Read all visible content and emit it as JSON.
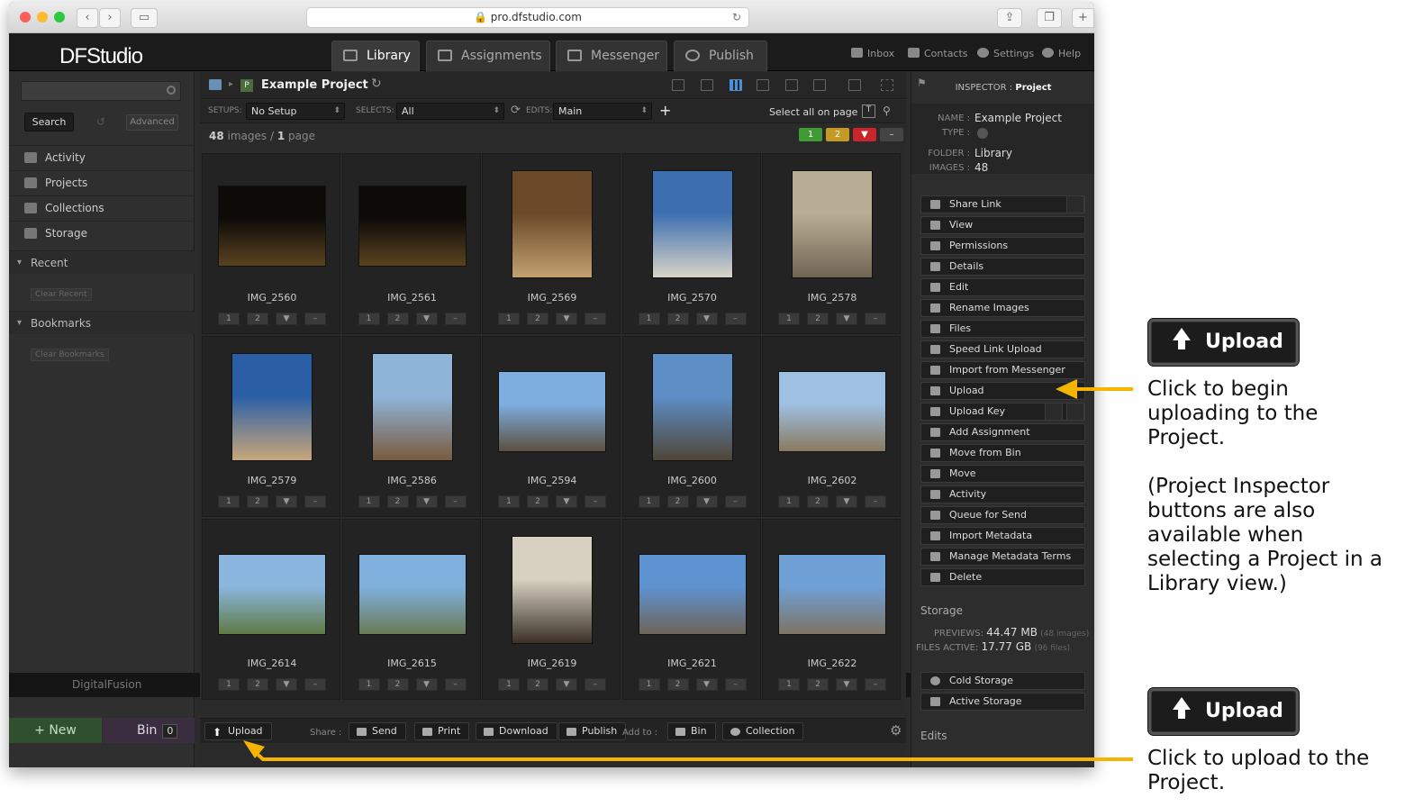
{
  "browser": {
    "url": "pro.dfstudio.com"
  },
  "app": {
    "logo": "DFStudio",
    "tabs": [
      {
        "label": "Library"
      },
      {
        "label": "Assignments"
      },
      {
        "label": "Messenger"
      },
      {
        "label": "Publish"
      }
    ],
    "top_links": [
      "Inbox",
      "Contacts",
      "Settings",
      "Help"
    ]
  },
  "left_panel": {
    "search_label": "Search",
    "advanced_label": "Advanced",
    "nav": [
      "Activity",
      "Projects",
      "Collections",
      "Storage"
    ],
    "recent_label": "Recent",
    "clear_recent": "Clear Recent",
    "bookmarks_label": "Bookmarks",
    "clear_bookmarks": "Clear Bookmarks",
    "new_label": "+ New",
    "bin_label": "Bin",
    "bin_count": "0",
    "footer_logo": "DigitalFusion"
  },
  "project": {
    "title": "Example Project",
    "setups_label": "SETUPS:",
    "setups_value": "No Setup",
    "selects_label": "SELECTS:",
    "selects_value": "All",
    "edits_label": "EDITS:",
    "edits_value": "Main",
    "select_all": "Select all on page",
    "image_count": "48",
    "images_word": "images /",
    "page_count": "1",
    "page_word": "page",
    "ratings": [
      "1",
      "2",
      "",
      "–"
    ]
  },
  "images": [
    {
      "name": "IMG_2560"
    },
    {
      "name": "IMG_2561"
    },
    {
      "name": "IMG_2569"
    },
    {
      "name": "IMG_2570"
    },
    {
      "name": "IMG_2578"
    },
    {
      "name": "IMG_2579"
    },
    {
      "name": "IMG_2586"
    },
    {
      "name": "IMG_2594"
    },
    {
      "name": "IMG_2600"
    },
    {
      "name": "IMG_2602"
    },
    {
      "name": "IMG_2614"
    },
    {
      "name": "IMG_2615"
    },
    {
      "name": "IMG_2619"
    },
    {
      "name": "IMG_2621"
    },
    {
      "name": "IMG_2622"
    }
  ],
  "bottom_bar": {
    "upload": "Upload",
    "share_label": "Share :",
    "send": "Send",
    "print": "Print",
    "download": "Download",
    "publish": "Publish",
    "add_to_label": "Add to :",
    "bin": "Bin",
    "collection": "Collection"
  },
  "inspector": {
    "header_prefix": "INSPECTOR :",
    "header_object": "Project",
    "name_label": "NAME :",
    "name_value": "Example Project",
    "type_label": "TYPE :",
    "folder_label": "FOLDER :",
    "folder_value": "Library",
    "images_label": "IMAGES :",
    "images_value": "48",
    "buttons": [
      "Share Link",
      "View",
      "Permissions",
      "Details",
      "Edit",
      "Rename Images",
      "Files",
      "Speed Link Upload",
      "Import from Messenger",
      "Upload",
      "Upload Key",
      "Add Assignment",
      "Move from Bin",
      "Move",
      "Activity",
      "Queue for Send",
      "Import Metadata",
      "Manage Metadata Terms",
      "Delete"
    ],
    "storage_title": "Storage",
    "previews_label": "PREVIEWS:",
    "previews_value": "44.47 MB",
    "previews_note": "(48 images)",
    "files_label": "FILES ACTIVE:",
    "files_value": "17.77 GB",
    "files_note": "(96 files)",
    "storage_buttons": [
      "Cold Storage",
      "Active Storage"
    ],
    "edits_title": "Edits"
  },
  "annotations": {
    "upload_label": "Upload",
    "note1_lines": [
      "Click to begin",
      "uploading to the",
      "Project."
    ],
    "note2_lines": [
      "(Project Inspector",
      "buttons are also",
      "available when",
      "selecting a Project in a",
      "Library view.)"
    ],
    "note3_lines": [
      "Click to upload to the",
      "Project."
    ],
    "arrow_color": "#f5b400"
  }
}
